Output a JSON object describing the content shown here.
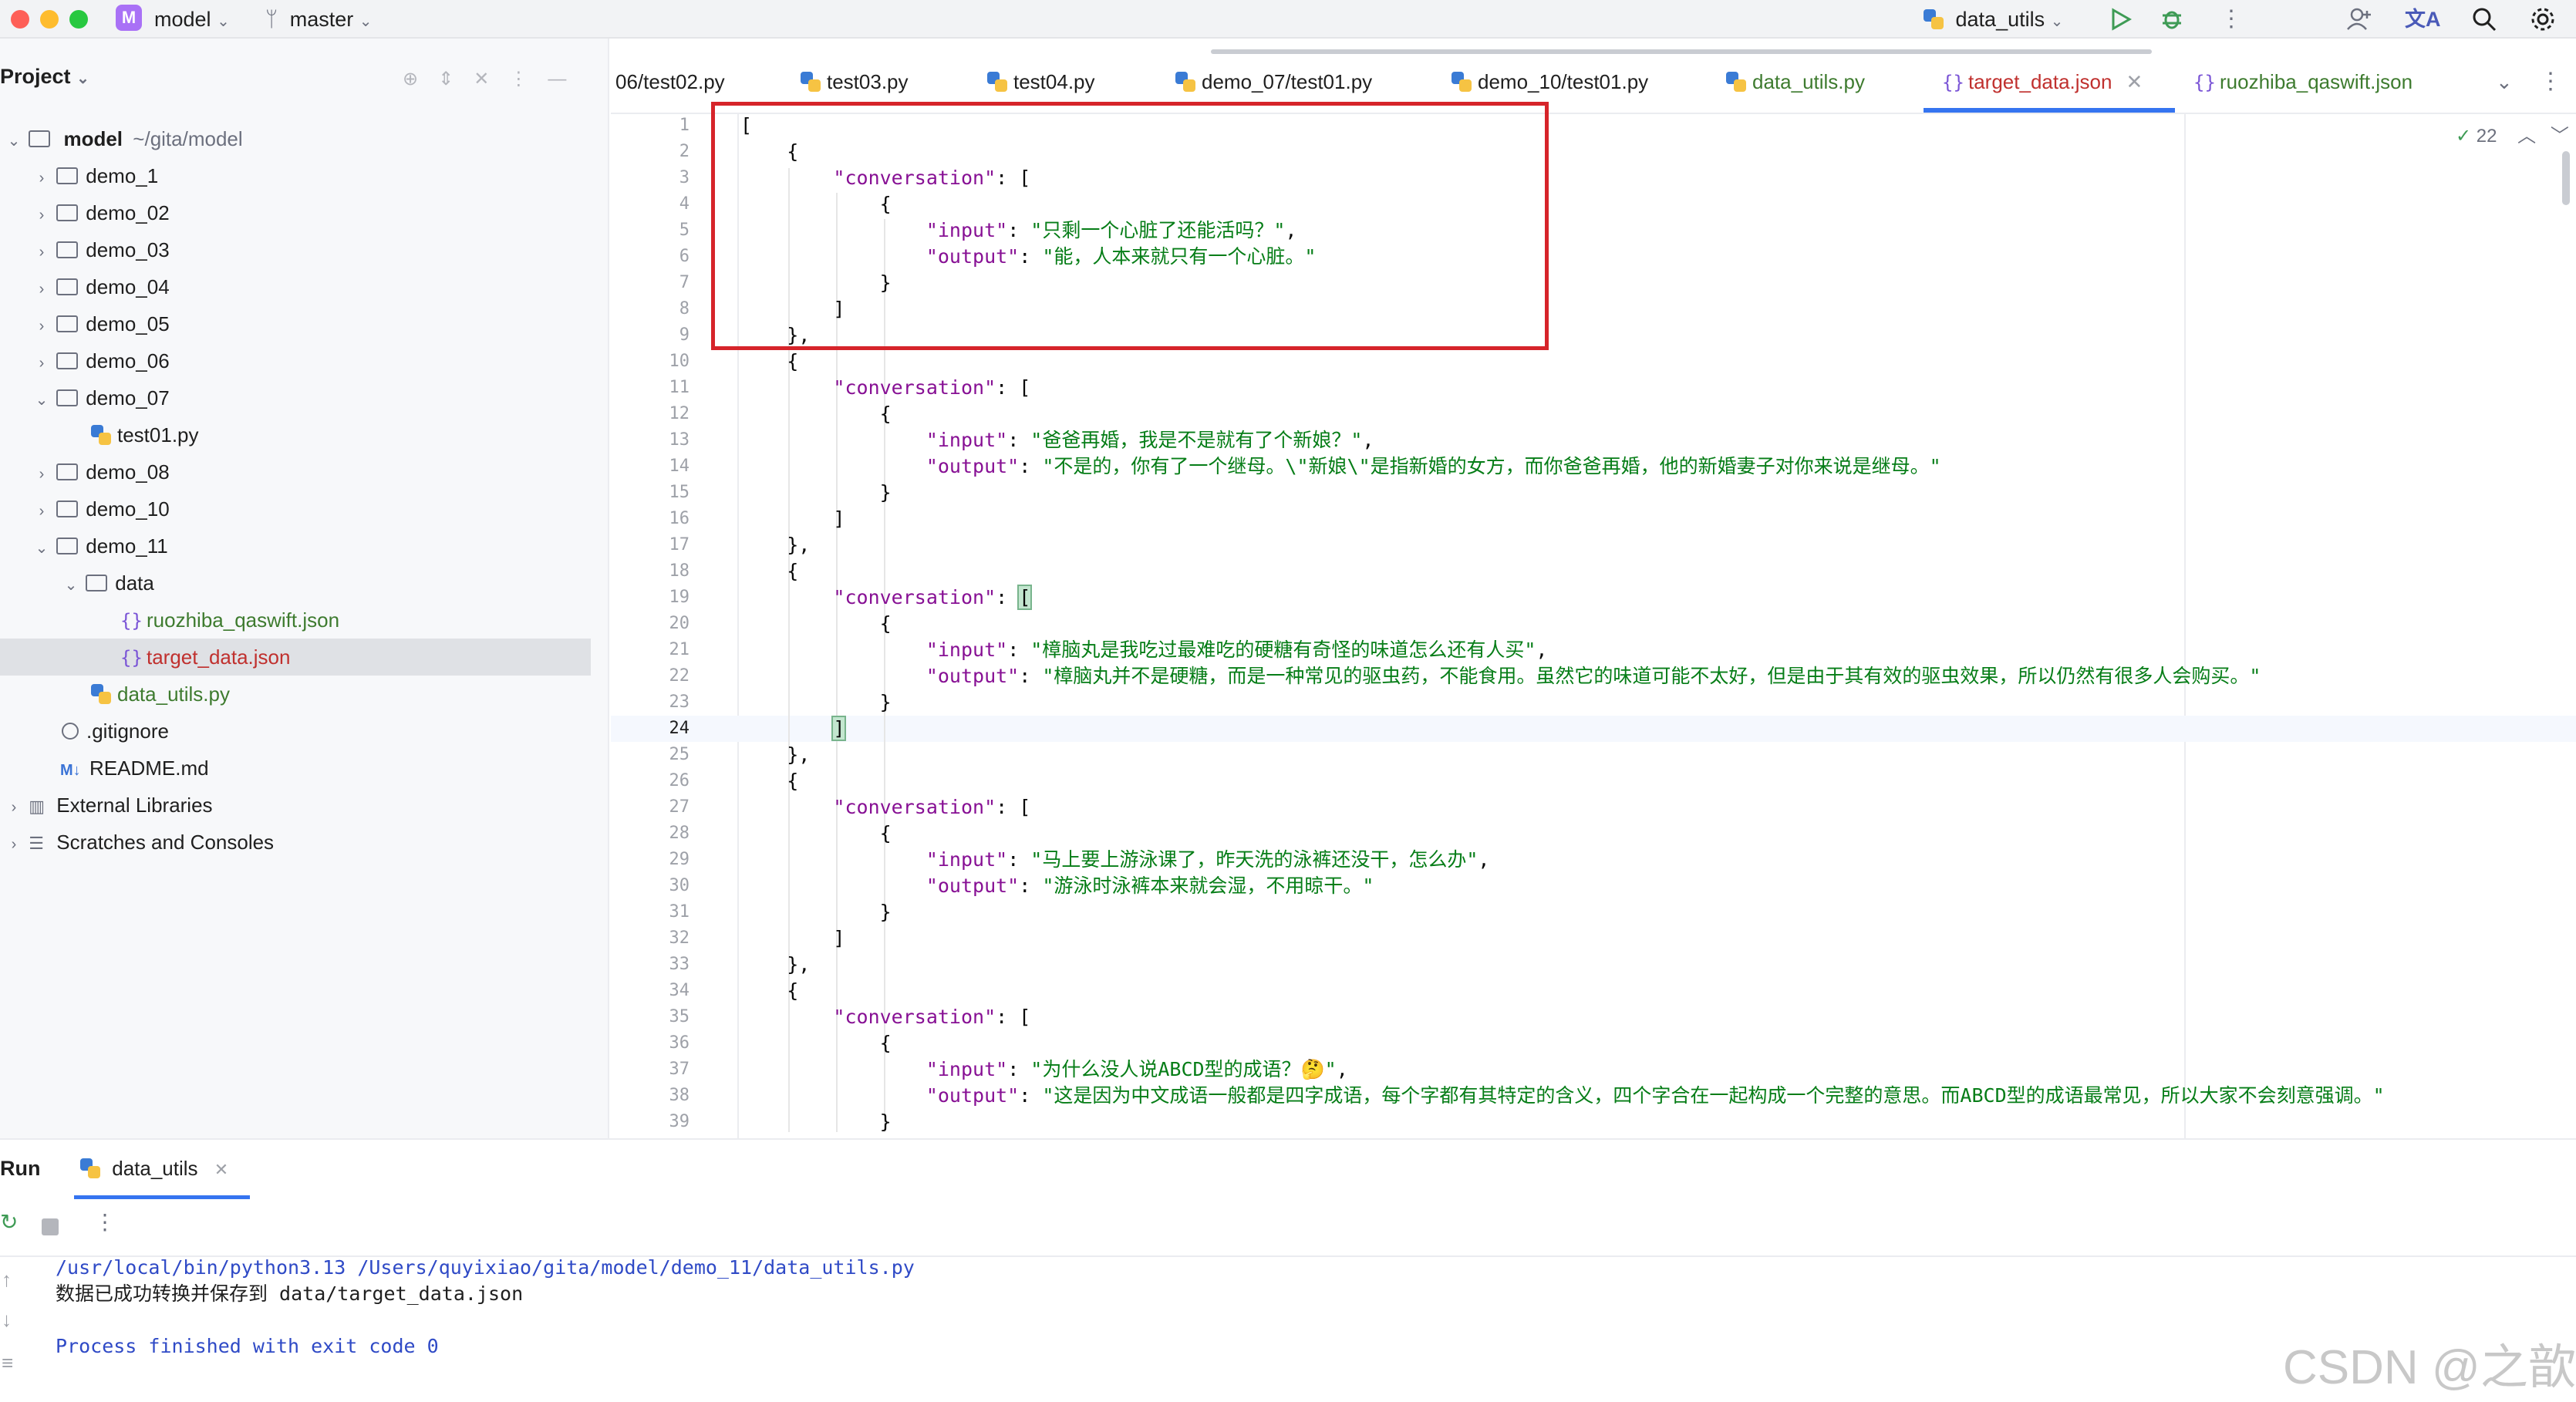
{
  "titlebar": {
    "project_badge": "M",
    "project_name": "model",
    "branch": "master",
    "run_config": "data_utils"
  },
  "project_panel": {
    "header": "Project",
    "root_name": "model",
    "root_path": "~/gita/model",
    "items": [
      {
        "label": "demo_1"
      },
      {
        "label": "demo_02"
      },
      {
        "label": "demo_03"
      },
      {
        "label": "demo_04"
      },
      {
        "label": "demo_05"
      },
      {
        "label": "demo_06"
      },
      {
        "label": "demo_07"
      },
      {
        "label": "test01.py"
      },
      {
        "label": "demo_08"
      },
      {
        "label": "demo_10"
      },
      {
        "label": "demo_11"
      },
      {
        "label": "data"
      },
      {
        "label": "ruozhiba_qaswift.json"
      },
      {
        "label": "target_data.json"
      },
      {
        "label": "data_utils.py"
      },
      {
        "label": ".gitignore"
      },
      {
        "label": "README.md"
      },
      {
        "label": "External Libraries"
      },
      {
        "label": "Scratches and Consoles"
      }
    ]
  },
  "tabs": [
    {
      "label": "06/test02.py"
    },
    {
      "label": "test03.py"
    },
    {
      "label": "test04.py"
    },
    {
      "label": "demo_07/test01.py"
    },
    {
      "label": "demo_10/test01.py"
    },
    {
      "label": "data_utils.py"
    },
    {
      "label": "target_data.json"
    },
    {
      "label": "ruozhiba_qaswift.json"
    }
  ],
  "editor": {
    "inspection_count": "22",
    "lines": [
      "[",
      "    {",
      "        \"conversation\": [",
      "            {",
      "                \"input\": \"只剩一个心脏了还能活吗？\",",
      "                \"output\": \"能，人本来就只有一个心脏。\"",
      "            }",
      "        ]",
      "    },",
      "    {",
      "        \"conversation\": [",
      "            {",
      "                \"input\": \"爸爸再婚，我是不是就有了个新娘？\",",
      "                \"output\": \"不是的，你有了一个继母。\\\"新娘\\\"是指新婚的女方，而你爸爸再婚，他的新婚妻子对你来说是继母。\"",
      "            }",
      "        ]",
      "    },",
      "    {",
      "        \"conversation\": [",
      "            {",
      "                \"input\": \"樟脑丸是我吃过最难吃的硬糖有奇怪的味道怎么还有人买\",",
      "                \"output\": \"樟脑丸并不是硬糖，而是一种常见的驱虫药，不能食用。虽然它的味道可能不太好，但是由于其有效的驱虫效果，所以仍然有很多人会购买。\"",
      "            }",
      "        ]",
      "    },",
      "    {",
      "        \"conversation\": [",
      "            {",
      "                \"input\": \"马上要上游泳课了，昨天洗的泳裤还没干，怎么办\",",
      "                \"output\": \"游泳时泳裤本来就会湿，不用晾干。\"",
      "            }",
      "        ]",
      "    },",
      "    {",
      "        \"conversation\": [",
      "            {",
      "                \"input\": \"为什么没人说ABCD型的成语？🤔\",",
      "                \"output\": \"这是因为中文成语一般都是四字成语，每个字都有其特定的含义，四个字合在一起构成一个完整的意思。而ABCD型的成语最常见，所以大家不会刻意强调。\"",
      "            }"
    ]
  },
  "run_panel": {
    "title": "Run",
    "tab_label": "data_utils",
    "console_lines": [
      "/usr/local/bin/python3.13 /Users/quyixiao/gita/model/demo_11/data_utils.py",
      "数据已成功转换并保存到 data/target_data.json",
      "",
      "Process finished with exit code 0"
    ]
  },
  "watermark": "CSDN @之歆",
  "colors": {
    "accent": "#3574f0",
    "highlight_box": "#d6242a",
    "json_key": "#871094",
    "json_string": "#067d17",
    "active_tab_text": "#c0302e"
  }
}
